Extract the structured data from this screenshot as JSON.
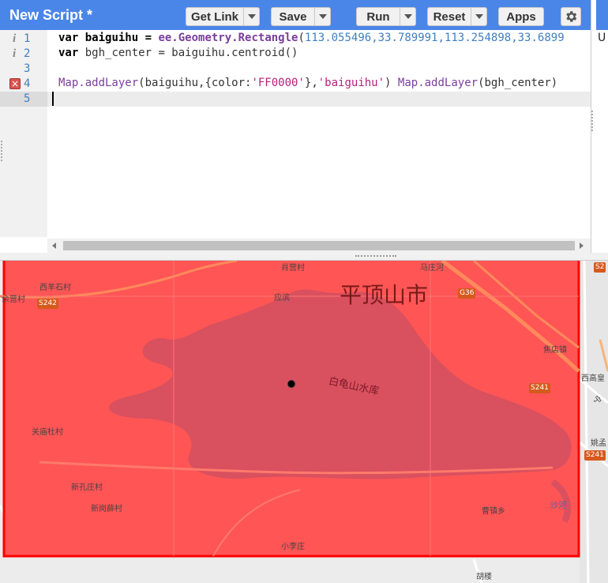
{
  "toolbar": {
    "title": "New Script *",
    "get_link": "Get Link",
    "save": "Save",
    "run": "Run",
    "reset": "Reset",
    "apps": "Apps",
    "settings_icon": "gear-icon"
  },
  "right_panel": {
    "partial_char": "U"
  },
  "editor": {
    "lines": [
      {
        "number": "1",
        "marker": "i"
      },
      {
        "number": "2",
        "marker": "i"
      },
      {
        "number": "3",
        "marker": ""
      },
      {
        "number": "4",
        "marker": "×"
      },
      {
        "number": "5",
        "marker": ""
      }
    ],
    "code": {
      "l1_var": "var",
      "l1_name": " baiguihu = ",
      "l1_fn": "ee.Geometry.Rectangle",
      "l1_open": "(",
      "l1_args": "113.055496,33.789991,113.254898,33.6899",
      "l2_var": "var",
      "l2_rest": " bgh_center = baiguihu.centroid()",
      "l4_a": "Map.addLayer",
      "l4_b": "(baiguihu,{color:",
      "l4_c": "'FF0000'",
      "l4_d": "},",
      "l4_e": "'baiguihu'",
      "l4_f": ") ",
      "l4_g": "Map.addLayer",
      "l4_h": "(bgh_center)"
    }
  },
  "map": {
    "city": "平顶山市",
    "reservoir": "白龟山水库",
    "rect_color": "#ff0000",
    "labels": {
      "xiyangshicun": "西羊石村",
      "yupancun": "余营村",
      "qiaoying": "肖营村",
      "yingbin": "应滨",
      "liaozhuang": "马庄河",
      "guanmiaodu": "关庙杜村",
      "xinkongzhuang": "新孔庄村",
      "xingangxue": "新岗薛村",
      "xiaolizhuang": "小李庄",
      "caozhen": "曹镇乡",
      "shahe": "沙河",
      "jiaodian": "焦店镇",
      "xigao": "西高皇",
      "yaomeng": "姚孟",
      "ning": "宁",
      "hulou": "胡楼"
    },
    "shields": {
      "s242": "S242",
      "g36": "G36",
      "s241a": "S241",
      "s241b": "S241",
      "s2_partial": "S2"
    }
  }
}
